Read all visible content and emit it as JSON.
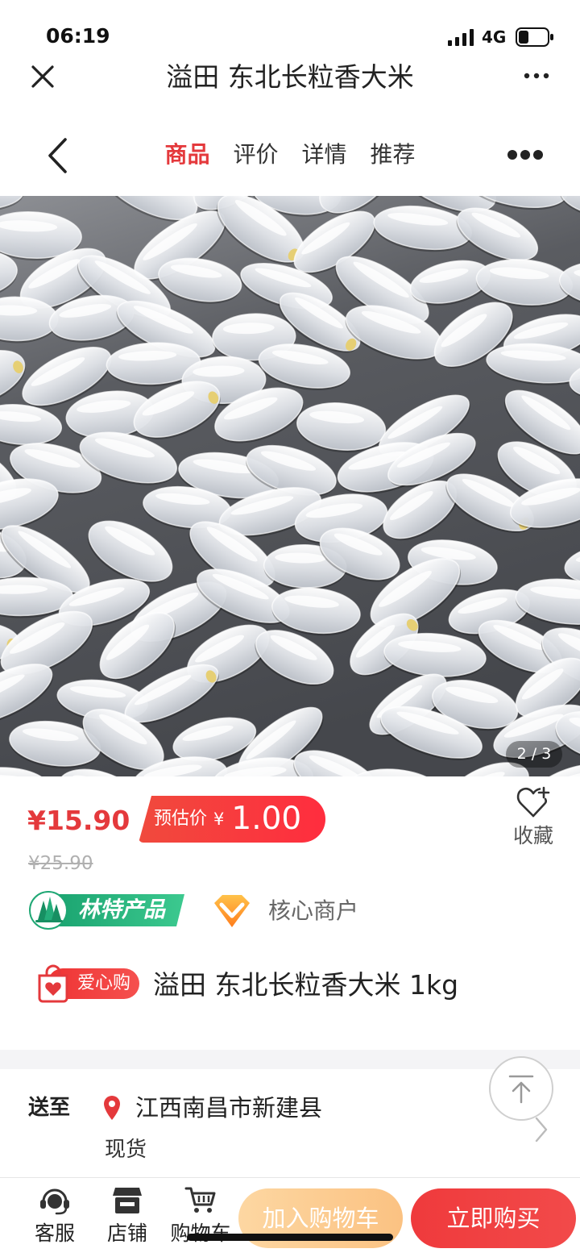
{
  "status_bar": {
    "time": "06:19",
    "network": "4G",
    "icons": {
      "signal": "signal-icon",
      "battery": "battery-icon"
    }
  },
  "title_bar": {
    "title": "溢田 东北长粒香大米",
    "icons": {
      "close": "close-icon",
      "more": "more-icon"
    }
  },
  "nav": {
    "tabs": [
      {
        "label": "商品",
        "active": true
      },
      {
        "label": "评价",
        "active": false
      },
      {
        "label": "详情",
        "active": false
      },
      {
        "label": "推荐",
        "active": false
      }
    ],
    "icons": {
      "back": "chevron-left-icon",
      "more": "more-dots-icon"
    }
  },
  "gallery": {
    "counter": "2 / 3"
  },
  "price": {
    "current": "¥15.90",
    "estimate_label": "预估价",
    "estimate_currency": "¥",
    "estimate_value": "1.00",
    "original": "¥25.90"
  },
  "favorite": {
    "label": "收藏",
    "icon": "heart-plus-icon"
  },
  "badges": {
    "forest_label": "林特产品",
    "forest_icon": "tree-icon",
    "merchant_label": "核心商户",
    "merchant_icon": "diamond-icon"
  },
  "product": {
    "tag_label": "爱心购",
    "tag_icon": "heart-bag-icon",
    "name": "溢田 东北长粒香大米 1kg"
  },
  "delivery": {
    "label": "送至",
    "address": "江西南昌市新建县",
    "stock": "现货",
    "icons": {
      "location": "location-pin-icon",
      "chevron": "chevron-right-icon",
      "back_to_top": "back-to-top-icon"
    }
  },
  "bottom_bar": {
    "service_label": "客服",
    "store_label": "店铺",
    "cart_label": "购物车",
    "add_to_cart": "加入购物车",
    "buy_now": "立即购买",
    "icons": {
      "service": "headset-icon",
      "store": "store-icon",
      "cart": "cart-icon"
    }
  },
  "colors": {
    "accent_red": "#e4393c",
    "ribbon_red": "#f04a3d",
    "buy_button_red": "#ef3a3c",
    "add_to_cart_orange": "#fdd7a2",
    "forest_green": "#22ad79",
    "merchant_orange": "#ff9a2e",
    "text_dark": "#222222",
    "text_muted": "#b0b0b0",
    "divider_gray": "#f4f4f6"
  }
}
